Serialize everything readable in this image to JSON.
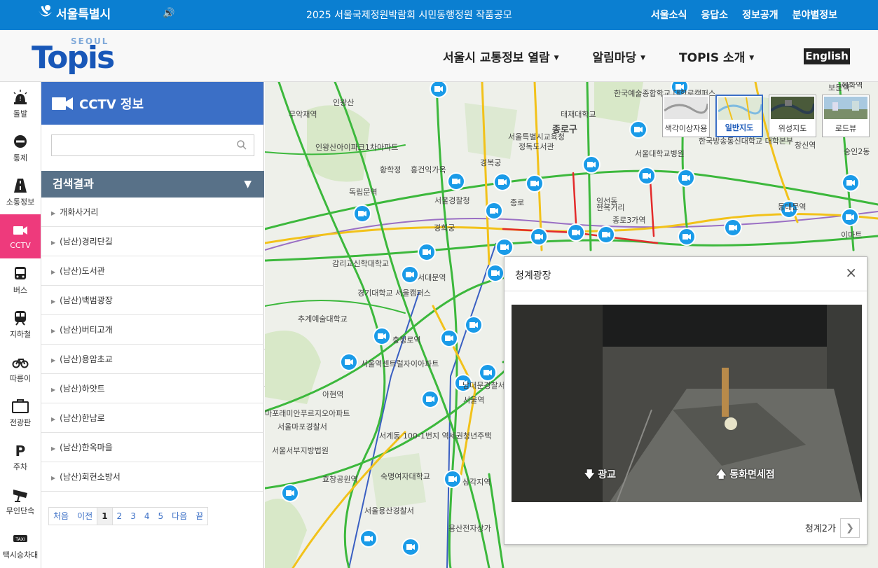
{
  "topbar": {
    "city_label": "서울특별시",
    "notice": "2025 서울국제정원박람회 시민동행정원 작품공모",
    "links": [
      "서울소식",
      "응답소",
      "정보공개",
      "분야별정보"
    ]
  },
  "header": {
    "logo_small": "SEOUL",
    "logo_main": "Topis",
    "nav": [
      "서울시 교통정보 열람",
      "알림마당",
      "TOPIS 소개"
    ],
    "english": "English"
  },
  "rail": [
    {
      "label": "돌발",
      "icon": "warning-light-icon"
    },
    {
      "label": "통제",
      "icon": "no-entry-icon"
    },
    {
      "label": "소통정보",
      "icon": "road-icon"
    },
    {
      "label": "CCTV",
      "icon": "video-camera-icon",
      "active": true
    },
    {
      "label": "버스",
      "icon": "bus-icon"
    },
    {
      "label": "지하철",
      "icon": "subway-icon"
    },
    {
      "label": "따릉이",
      "icon": "bicycle-icon"
    },
    {
      "label": "전광판",
      "icon": "signboard-icon"
    },
    {
      "label": "주차",
      "icon": "parking-icon"
    },
    {
      "label": "무인단속",
      "icon": "speed-camera-icon"
    },
    {
      "label": "택시승차대",
      "icon": "taxi-icon"
    }
  ],
  "panel": {
    "title": "CCTV 정보",
    "search_value": "",
    "results_title": "검색결과",
    "results": [
      "개화사거리",
      "(남산)경리단길",
      "(남산)도서관",
      "(남산)백범광장",
      "(남산)버티고개",
      "(남산)용암초교",
      "(남산)하얏트",
      "(남산)한남로",
      "(남산)한옥마을",
      "(남산)회현소방서"
    ],
    "pager": [
      "처음",
      "이전",
      "1",
      "2",
      "3",
      "4",
      "5",
      "다음",
      "끝"
    ],
    "current_page": "1"
  },
  "map": {
    "map_types": [
      "색각이상자용",
      "일반지도",
      "위성지도",
      "로드뷰"
    ],
    "selected_type": "일반지도",
    "labels": [
      "종로구",
      "서울특별시교육청",
      "정독도서관",
      "경복궁",
      "서울경찰청",
      "경희궁",
      "종로",
      "익선동",
      "한옥거리",
      "종로3가역",
      "감리교신학대학교",
      "서대문역",
      "경기대학교 서울캠퍼스",
      "충정로역",
      "서울역센트럴자이아파트",
      "서울역",
      "숙명여자대학교",
      "삼각지역",
      "서울용산경찰서",
      "혜화역",
      "동대문역",
      "창신역",
      "이마트",
      "서울대학교병원",
      "한국방송통신대학교 대학본부",
      "한국예술종합학교 대학로캠퍼스",
      "태재대학교",
      "인왕산",
      "무악재역",
      "인왕산아이파크1차아파트",
      "황학정",
      "홍건익가옥",
      "독립문역",
      "추계예술대학교",
      "아현역",
      "마포래미안푸르지오아파트",
      "서울마포경찰서",
      "서울서부지방법원",
      "효창공원역",
      "남대문경찰서",
      "서계동 100-1번지 역세권청년주택",
      "용산전자상가",
      "숭인2동",
      "보문역"
    ]
  },
  "popup": {
    "title": "청계광장",
    "close": "×",
    "cam_label_left": "광교",
    "cam_label_right": "동화면세점",
    "next_label": "청계2가"
  }
}
